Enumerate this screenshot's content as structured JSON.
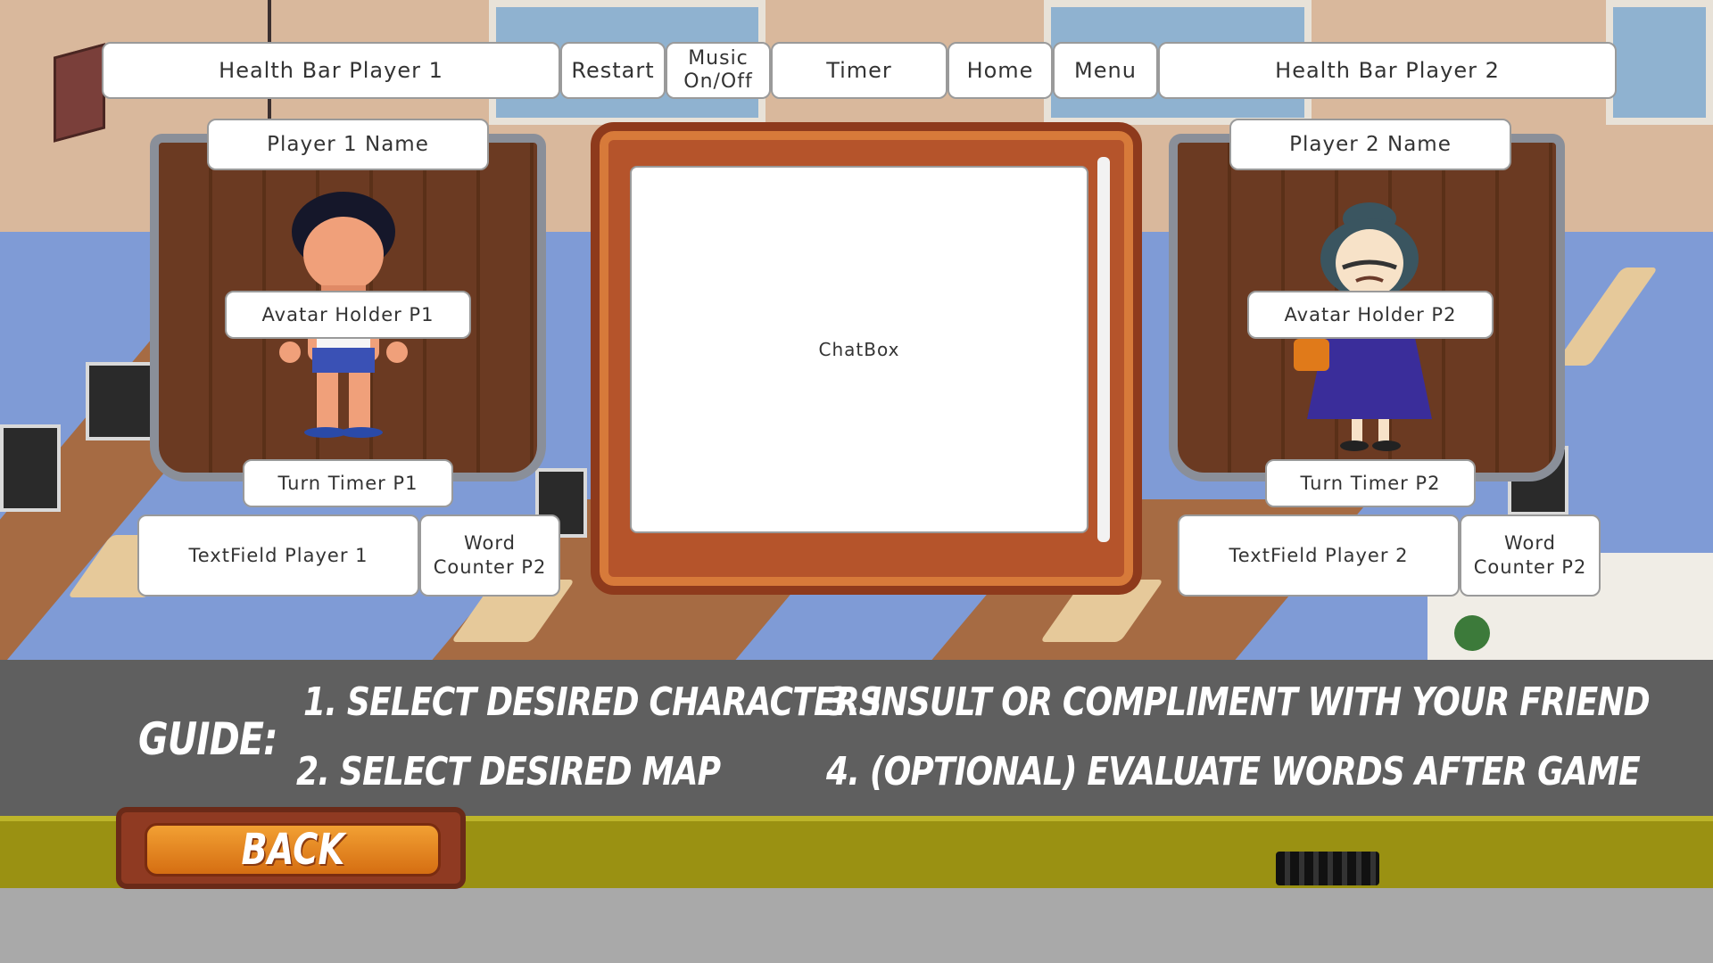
{
  "top_bar": {
    "health_p1": "Health Bar Player 1",
    "restart": "Restart",
    "music": "Music On/Off",
    "timer": "Timer",
    "home": "Home",
    "menu": "Menu",
    "health_p2": "Health Bar Player 2"
  },
  "player1": {
    "name": "Player 1 Name",
    "avatar": "Avatar Holder P1",
    "turn_timer": "Turn Timer P1",
    "textfield": "TextField Player 1",
    "word_counter": "Word Counter P2"
  },
  "player2": {
    "name": "Player 2 Name",
    "avatar": "Avatar Holder P2",
    "turn_timer": "Turn Timer P2",
    "textfield": "TextField Player 2",
    "word_counter": "Word Counter P2"
  },
  "chatbox": "ChatBox",
  "guide": {
    "label": "GUIDE:",
    "steps": [
      "1. SELECT DESIRED CHARACTERS",
      "2. SELECT DESIRED MAP",
      "3. INSULT OR COMPLIMENT  WITH YOUR FRIEND",
      "4. (OPTIONAL) EVALUATE WORDS AFTER GAME"
    ]
  },
  "back_button": "BACK"
}
